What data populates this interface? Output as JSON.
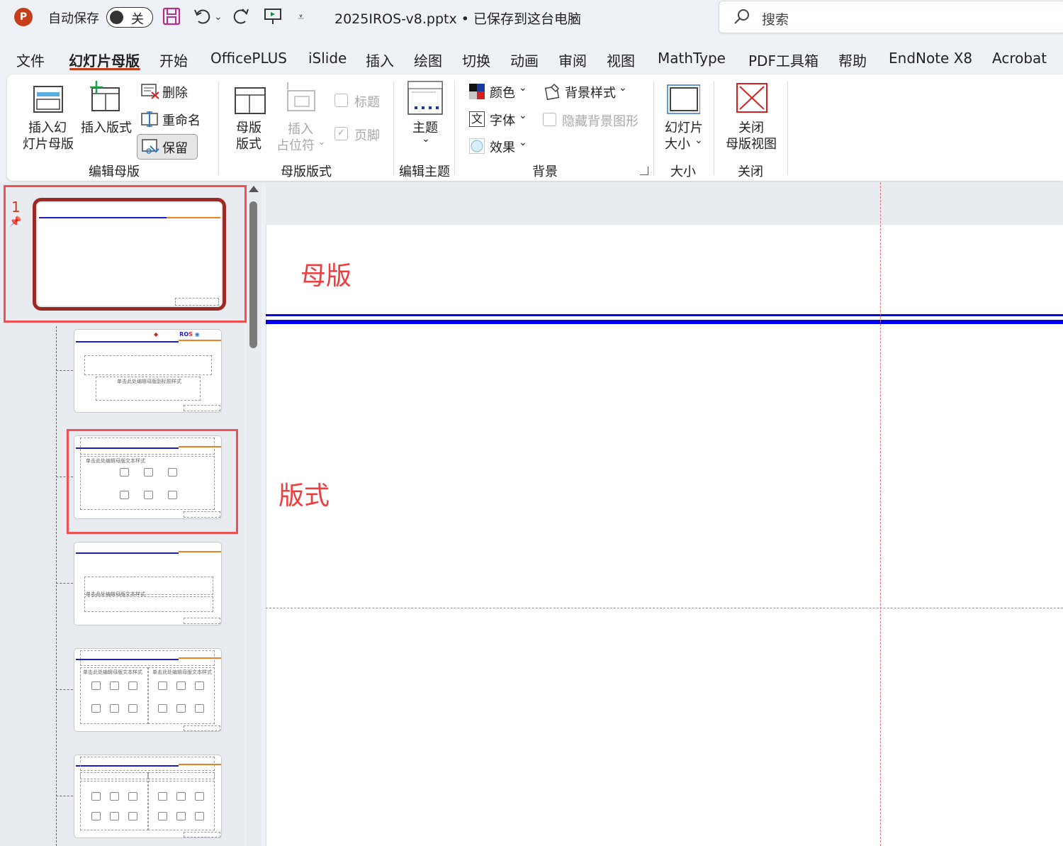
{
  "titlebar": {
    "logo": "P",
    "autosave_label": "自动保存",
    "autosave_state": "关",
    "doc_title": "2025IROS-v8.pptx • 已保存到这台电脑",
    "search_placeholder": "搜索"
  },
  "tabs": [
    {
      "label": "文件"
    },
    {
      "label": "幻灯片母版"
    },
    {
      "label": "开始"
    },
    {
      "label": "OfficePLUS"
    },
    {
      "label": "iSlide"
    },
    {
      "label": "插入"
    },
    {
      "label": "绘图"
    },
    {
      "label": "切换"
    },
    {
      "label": "动画"
    },
    {
      "label": "审阅"
    },
    {
      "label": "视图"
    },
    {
      "label": "MathType"
    },
    {
      "label": "PDF工具箱"
    },
    {
      "label": "帮助"
    },
    {
      "label": "EndNote X8"
    },
    {
      "label": "Acrobat"
    }
  ],
  "ribbon": {
    "edit_master": {
      "insert_master_1": "插入幻",
      "insert_master_2": "灯片母版",
      "insert_layout": "插入版式",
      "delete": "删除",
      "rename": "重命名",
      "preserve": "保留",
      "group_label": "编辑母版"
    },
    "master_layout": {
      "master_layout_1": "母版",
      "master_layout_2": "版式",
      "insert_placeholder_1": "插入",
      "insert_placeholder_2": "占位符",
      "title": "标题",
      "footer": "页脚",
      "group_label": "母版版式"
    },
    "edit_theme": {
      "themes": "主题",
      "group_label": "编辑主题"
    },
    "background": {
      "colors": "颜色",
      "fonts": "字体",
      "effects": "效果",
      "bg_styles": "背景样式",
      "hide_bg": "隐藏背景图形",
      "group_label": "背景"
    },
    "size": {
      "slide_size_1": "幻灯片",
      "slide_size_2": "大小",
      "group_label": "大小"
    },
    "close": {
      "close_1": "关闭",
      "close_2": "母版视图",
      "group_label": "关闭"
    }
  },
  "thumbnails": {
    "slide_number": "1",
    "layout2_text": "单击此处编辑母版副标题样式",
    "layout3_text": "单击此处编辑母版文本样式",
    "layout4_text": "单击此处编辑母版文本样式",
    "layout5_left": "单击此处编辑母版文本样式",
    "layout5_right": "单击此处编辑母版文本样式"
  },
  "annotations": {
    "master": "母版",
    "layout": "版式"
  },
  "colors": {
    "accent": "#c43e1c",
    "annotation_red": "#f03c3c",
    "slide_line_blue": "#0000ee"
  }
}
